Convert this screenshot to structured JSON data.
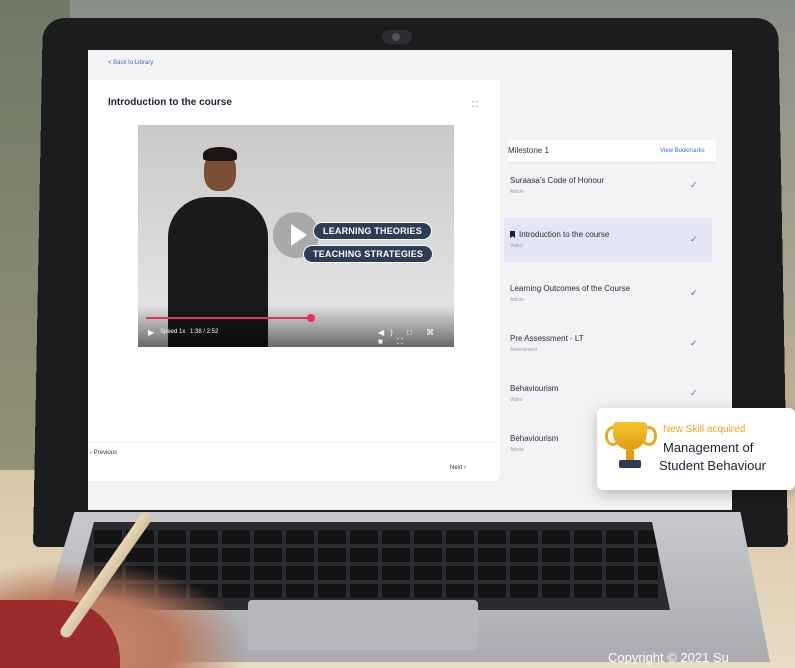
{
  "nav": {
    "back_link": "< Back to Library"
  },
  "lesson": {
    "title": "Introduction to the course",
    "expand_icon": "expand-icon"
  },
  "video": {
    "overlay_line1": "LEARNING THEORIES",
    "overlay_line2": "TEACHING STRATEGIES",
    "speed_label": "Speed 1x",
    "time": "1:38 / 2:52",
    "progress": 0.55,
    "control_icons": "◀) □ ⌘ ■ ⛶"
  },
  "footer": {
    "previous": "‹ Previous",
    "next": "Next ›"
  },
  "sidebar": {
    "milestone": "Milestone 1",
    "view_bookmarks": "View Bookmarks",
    "items": [
      {
        "title": "Suraasa's Code of Honour",
        "type": "Article",
        "done": true,
        "active": false,
        "bookmarked": false
      },
      {
        "title": "Introduction to the course",
        "type": "Video",
        "done": true,
        "active": true,
        "bookmarked": true
      },
      {
        "title": "Learning Outcomes of the Course",
        "type": "Article",
        "done": true,
        "active": false,
        "bookmarked": false
      },
      {
        "title": "Pre Assessment - LT",
        "type": "Assessment",
        "done": true,
        "active": false,
        "bookmarked": false
      },
      {
        "title": "Behaviourism",
        "type": "Video",
        "done": true,
        "active": false,
        "bookmarked": false
      },
      {
        "title": "Behaviourism",
        "type": "Article",
        "done": false,
        "active": false,
        "bookmarked": false
      }
    ]
  },
  "skill_card": {
    "label": "New Skill acquired",
    "name_line1": "Management of",
    "name_line2": "Student Behaviour"
  },
  "copyright": "Copyright © 2021 Su",
  "colors": {
    "accent": "#3a6bd6",
    "progress": "#e4315a",
    "trophy": "#f0a31b"
  }
}
